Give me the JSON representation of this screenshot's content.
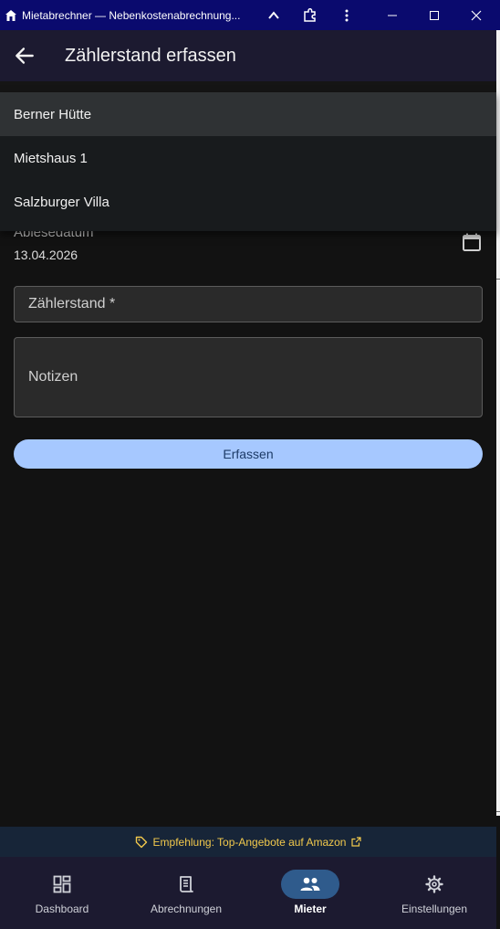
{
  "window": {
    "title": "Mietabrechner — Nebenkostenabrechnung..."
  },
  "appbar": {
    "title": "Zählerstand erfassen"
  },
  "dropdown": {
    "options": [
      "Berner Hütte",
      "Mietshaus 1",
      "Salzburger Villa"
    ],
    "selected": "Berner Hütte"
  },
  "form": {
    "date_label": "Ablesedatum",
    "date_value": "13.04.2026",
    "counter_placeholder": "Zählerstand *",
    "notes_placeholder": "Notizen",
    "submit_label": "Erfassen"
  },
  "promo": {
    "text": "Empfehlung: Top-Angebote auf Amazon"
  },
  "bottom_nav": {
    "items": [
      {
        "label": "Dashboard",
        "icon": "dashboard-icon"
      },
      {
        "label": "Abrechnungen",
        "icon": "receipt-icon"
      },
      {
        "label": "Mieter",
        "icon": "people-icon"
      },
      {
        "label": "Einstellungen",
        "icon": "gear-icon"
      }
    ],
    "active": "Mieter"
  },
  "colors": {
    "titlebar": "#0a0a6e",
    "appbar": "#1c1a30",
    "accent_button": "#a6c8ff",
    "promo_text": "#f2c94c",
    "nav_active_pill": "#2f5b8c"
  }
}
